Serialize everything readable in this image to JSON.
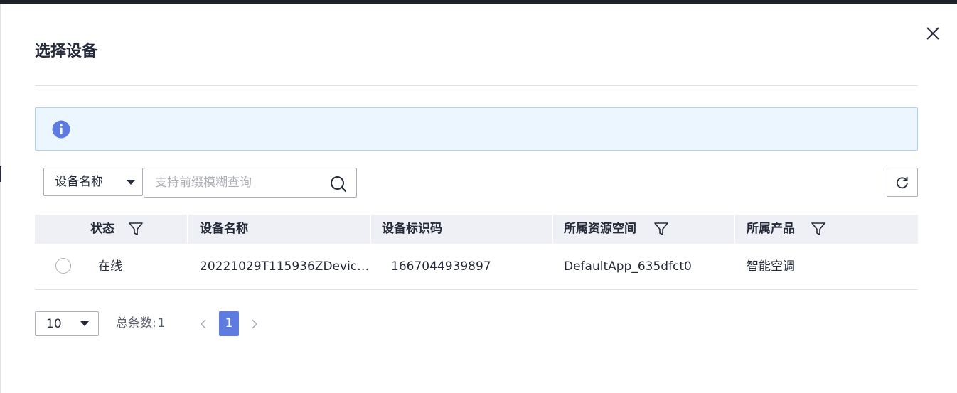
{
  "dialog": {
    "title": "选择设备",
    "info_text": ""
  },
  "search": {
    "field_value": "设备名称",
    "placeholder": "支持前缀模糊查询"
  },
  "table": {
    "columns": [
      "状态",
      "设备名称",
      "设备标识码",
      "所属资源空间",
      "所属产品"
    ],
    "rows": [
      {
        "status": "在线",
        "device_name": "20221029T115936ZDevic…",
        "device_id": "1667044939897",
        "resource_space": "DefaultApp_635dfct0",
        "product": "智能空调"
      }
    ]
  },
  "pagination": {
    "page_size": "10",
    "total_label": "总条数:",
    "total_value": "1",
    "current_page": "1"
  },
  "colors": {
    "accent": "#5e7ce0",
    "info_bg": "#ebf6ff",
    "info_border": "#a9d3f7",
    "header_bg": "#eef0f5"
  },
  "icons": [
    "close-icon",
    "info-icon",
    "search-icon",
    "refresh-icon",
    "filter-icon",
    "chevron-left-icon",
    "chevron-right-icon"
  ]
}
